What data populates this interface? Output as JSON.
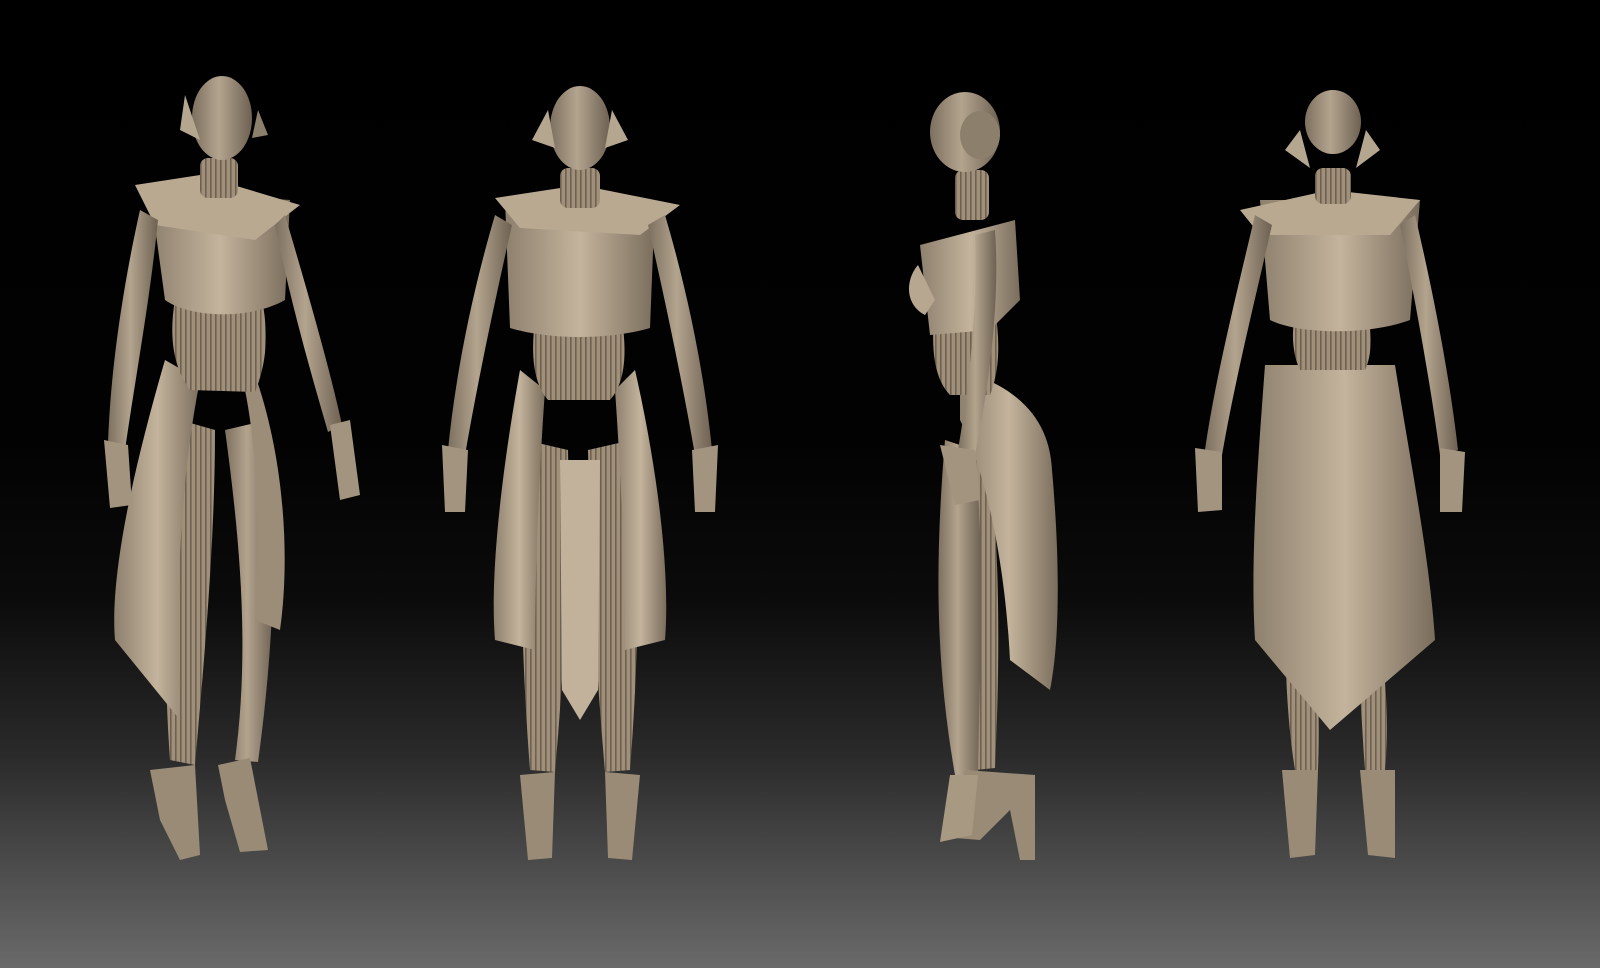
{
  "scene": {
    "background": {
      "top": "#000000",
      "bottom": "#6a6a6a"
    },
    "material": {
      "base": "#a39480",
      "light": "#c9b9a2",
      "shadow": "#6e6152",
      "line": "#5a4f43"
    },
    "views": [
      {
        "name": "three-quarter-front"
      },
      {
        "name": "front"
      },
      {
        "name": "side"
      },
      {
        "name": "back"
      }
    ]
  }
}
